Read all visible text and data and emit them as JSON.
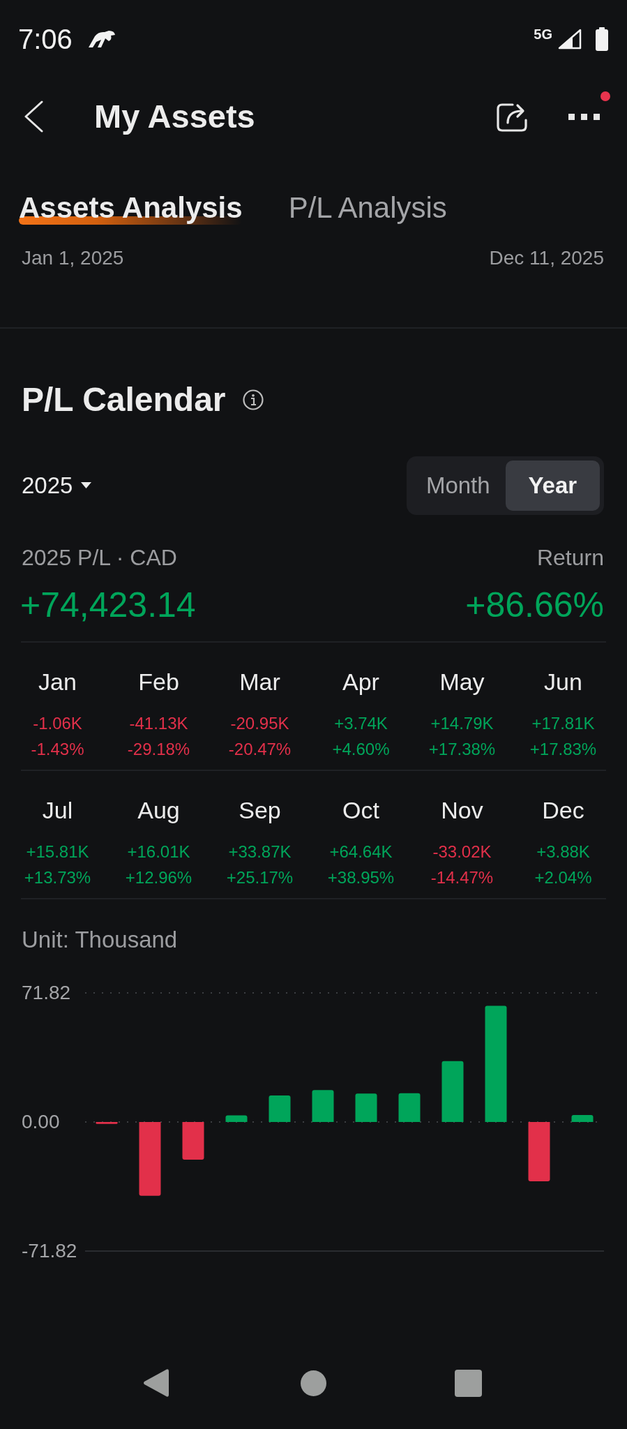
{
  "status_bar": {
    "time": "7:06",
    "network": "5G"
  },
  "header": {
    "title": "My Assets",
    "menu_badge": true
  },
  "tabs": [
    {
      "label": "Assets Analysis",
      "selected": true
    },
    {
      "label": "P/L Analysis",
      "selected": false
    }
  ],
  "date_range": {
    "start": "Jan 1, 2025",
    "end": "Dec 11, 2025"
  },
  "pl_calendar": {
    "title": "P/L Calendar",
    "year": "2025",
    "view_options": [
      {
        "label": "Month",
        "selected": false
      },
      {
        "label": "Year",
        "selected": true
      }
    ],
    "summary": {
      "pl_label": "2025 P/L · CAD",
      "return_label": "Return",
      "pl_value": "+74,423.14",
      "return_value": "+86.66%",
      "negative": false
    },
    "months": [
      {
        "name": "Jan",
        "pl": "-1.06K",
        "return": "-1.43%",
        "negative": true
      },
      {
        "name": "Feb",
        "pl": "-41.13K",
        "return": "-29.18%",
        "negative": true
      },
      {
        "name": "Mar",
        "pl": "-20.95K",
        "return": "-20.47%",
        "negative": true
      },
      {
        "name": "Apr",
        "pl": "+3.74K",
        "return": "+4.60%",
        "negative": false
      },
      {
        "name": "May",
        "pl": "+14.79K",
        "return": "+17.38%",
        "negative": false
      },
      {
        "name": "Jun",
        "pl": "+17.81K",
        "return": "+17.83%",
        "negative": false
      },
      {
        "name": "Jul",
        "pl": "+15.81K",
        "return": "+13.73%",
        "negative": false
      },
      {
        "name": "Aug",
        "pl": "+16.01K",
        "return": "+12.96%",
        "negative": false
      },
      {
        "name": "Sep",
        "pl": "+33.87K",
        "return": "+25.17%",
        "negative": false
      },
      {
        "name": "Oct",
        "pl": "+64.64K",
        "return": "+38.95%",
        "negative": false
      },
      {
        "name": "Nov",
        "pl": "-33.02K",
        "return": "-14.47%",
        "negative": true
      },
      {
        "name": "Dec",
        "pl": "+3.88K",
        "return": "+2.04%",
        "negative": false
      }
    ],
    "chart": {
      "unit_label": "Unit: Thousand",
      "chart_data": {
        "type": "bar",
        "values": [
          -1.1,
          -41.1,
          -21.0,
          3.7,
          14.8,
          17.8,
          15.8,
          16.0,
          33.9,
          64.6,
          -33.0,
          3.9
        ],
        "ylim": [
          -71.82,
          71.82
        ],
        "yticks": [
          {
            "value": 71.82,
            "label": "71.82"
          },
          {
            "value": 0,
            "label": "0.00"
          },
          {
            "value": -71.82,
            "label": "-71.82"
          }
        ]
      }
    }
  }
}
